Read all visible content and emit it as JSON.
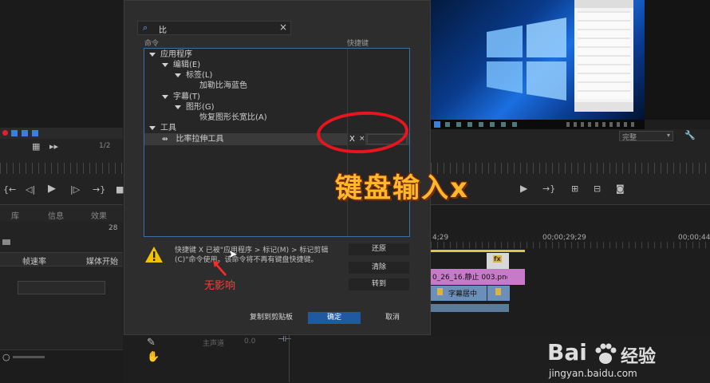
{
  "dialog": {
    "search_value": "比",
    "clear_icon": "×",
    "col_command": "命令",
    "col_shortcut": "快捷键",
    "tree": [
      {
        "label": "应用程序",
        "level": 0,
        "expanded": true
      },
      {
        "label": "编辑(E)",
        "level": 1,
        "expanded": true
      },
      {
        "label": "标签(L)",
        "level": 2,
        "expanded": true
      },
      {
        "label": "加勒比海蓝色",
        "level": 3
      },
      {
        "label": "字幕(T)",
        "level": 1,
        "expanded": true
      },
      {
        "label": "图形(G)",
        "level": 2,
        "expanded": true
      },
      {
        "label": "恢复图形长宽比(A)",
        "level": 3
      },
      {
        "label": "工具",
        "level": 0,
        "expanded": true
      },
      {
        "label": "比率拉伸工具",
        "level": 1,
        "shortcut": "X",
        "selected": true
      }
    ],
    "shortcut_remove": "×",
    "warning_text_line1": "快捷键 X 已被\"应用程序 > 标记(M) > 标记剪辑",
    "warning_text_line2": "(C)\"命令使用。该命令将不再有键盘快捷键。",
    "btn_undo": "还原",
    "btn_clear": "清除",
    "btn_goto": "转到",
    "btn_copy": "复制到剪贴板",
    "btn_ok": "确定",
    "btn_cancel": "取消"
  },
  "annotation": "无影响",
  "overlay_caption": "键盘输入x",
  "left_panel": {
    "page_fraction": "1/2",
    "tabs": [
      "库",
      "信息",
      "效果"
    ],
    "count": "28",
    "col_framerate": "帧速率",
    "col_media_start": "媒体开始"
  },
  "right_panel": {
    "quality": "完整",
    "timecode_a": "4;29",
    "timecode_b": "00;00;29;29",
    "timecode_c": "00;00;44;",
    "clip_a": "0_26_16.静止 003.png",
    "clip_b": "字幕居中",
    "fx": "fx"
  },
  "bottom": {
    "track_label": "主声道",
    "track_value": "0.0"
  },
  "watermark": {
    "brand": "Bai",
    "brand2": "经验",
    "url": "jingyan.baidu.com"
  },
  "colors": {
    "accent_blue": "#3d6fa8",
    "ok_button": "#1f5aa0",
    "annotation_red": "#e8151f",
    "caption_orange": "#ffb72b",
    "clip_pink": "#c77ac7",
    "clip_blue": "#6b8fb8"
  }
}
